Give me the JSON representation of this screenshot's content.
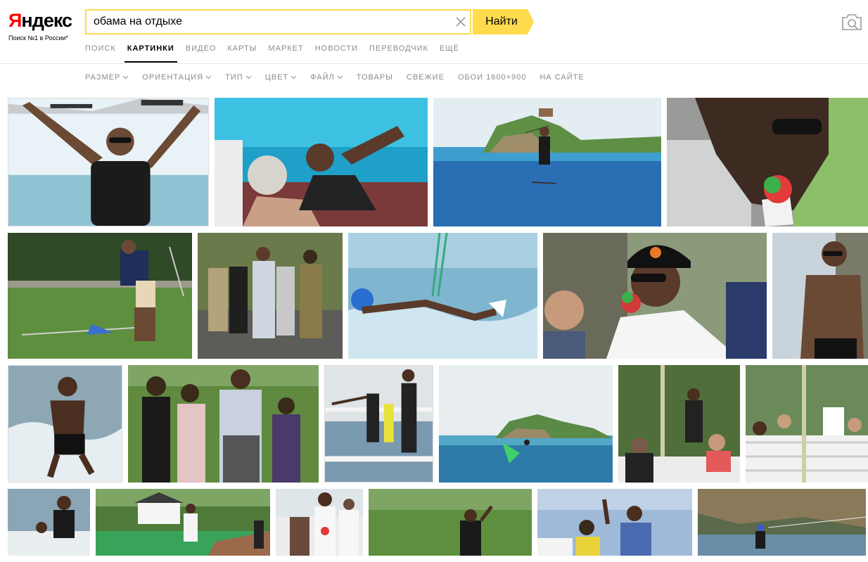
{
  "logo": {
    "text_first": "Я",
    "text_rest": "ндекс",
    "tagline": "Поиск №1 в России*"
  },
  "search": {
    "query": "обама на отдыхе",
    "button_label": "Найти"
  },
  "tabs": [
    {
      "label": "Поиск",
      "active": false
    },
    {
      "label": "Картинки",
      "active": true
    },
    {
      "label": "Видео",
      "active": false
    },
    {
      "label": "Карты",
      "active": false
    },
    {
      "label": "Маркет",
      "active": false
    },
    {
      "label": "Новости",
      "active": false
    },
    {
      "label": "Переводчик",
      "active": false
    },
    {
      "label": "Ещё",
      "active": false
    }
  ],
  "filters": [
    {
      "label": "Размер",
      "dropdown": true
    },
    {
      "label": "Ориентация",
      "dropdown": true
    },
    {
      "label": "Тип",
      "dropdown": true
    },
    {
      "label": "Цвет",
      "dropdown": true
    },
    {
      "label": "Файл",
      "dropdown": true
    },
    {
      "label": "Товары",
      "dropdown": false
    },
    {
      "label": "Свежие",
      "dropdown": false
    },
    {
      "label": "Обои 1600×900",
      "dropdown": false
    },
    {
      "label": "На сайте",
      "dropdown": false
    }
  ],
  "colors": {
    "brand_red": "#ff0000",
    "accent_yellow": "#ffdb4d",
    "muted": "#8a8a8a"
  },
  "icons": {
    "clear": "close-icon",
    "camera": "camera-icon",
    "caret": "chevron-down-icon"
  }
}
